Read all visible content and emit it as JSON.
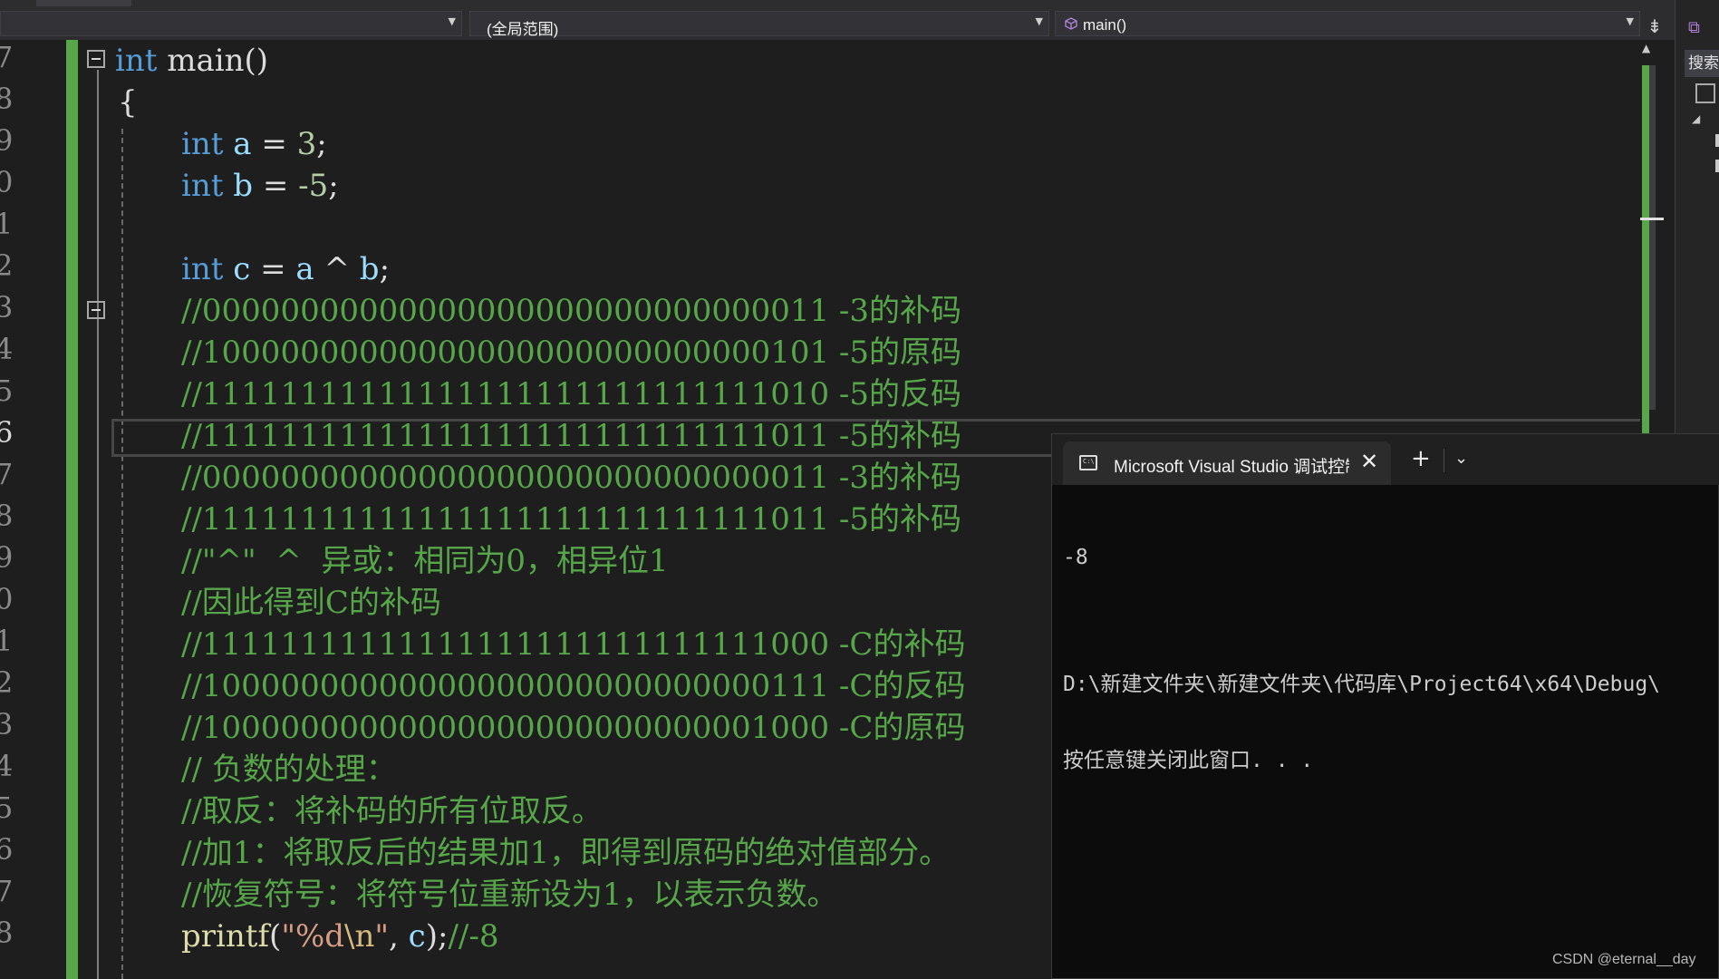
{
  "navbar": {
    "project_dropdown": "",
    "scope_dropdown": "(全局范围)",
    "member_dropdown": "main()"
  },
  "gutter": {
    "line_numbers": [
      "7",
      "8",
      "9",
      "0",
      "1",
      "2",
      "3",
      "4",
      "5",
      "6",
      "7",
      "8",
      "9",
      "0",
      "1",
      "2",
      "3",
      "4",
      "5",
      "6",
      "7",
      "8"
    ],
    "current_index": 9
  },
  "code": {
    "l1": {
      "kw": "int",
      "rest": " main()"
    },
    "l2": {
      "text": "{"
    },
    "l3": {
      "kw": "int",
      "var": "a",
      "op": " = ",
      "num": "3",
      "end": ";"
    },
    "l4": {
      "kw": "int",
      "var": "b",
      "op": " = ",
      "num": "-5",
      "end": ";"
    },
    "l6": {
      "kw": "int",
      "var": "c",
      "op1": " = ",
      "v2": "a",
      "op2": " ^ ",
      "v3": "b",
      "end": ";"
    },
    "comments": [
      "//00000000000000000000000000000011 -3的补码",
      "//10000000000000000000000000000101 -5的原码",
      "//11111111111111111111111111111010 -5的反码",
      "//11111111111111111111111111111011 -5的补码",
      "//00000000000000000000000000000011 -3的补码",
      "//11111111111111111111111111111011 -5的补码",
      "//\"^\"  ^  异或：相同为0，相异位1",
      "//因此得到C的补码",
      "//11111111111111111111111111111000 -C的补码",
      "//10000000000000000000000000000111 -C的反码",
      "//10000000000000000000000000001000 -C的原码",
      "// 负数的处理：",
      "//取反：将补码的所有位取反。",
      "//加1：将取反后的结果加1，即得到原码的绝对值部分。",
      "//恢复符号：将符号位重新设为1，以表示负数。"
    ],
    "printf": {
      "fn": "printf",
      "p1": "(",
      "fmt1": "\"%d",
      "esc": "\\n",
      "fmt2": "\"",
      "sep": ", ",
      "var": "c",
      "end": ");",
      "cm": "//-8"
    }
  },
  "right_panel": {
    "search_label": "搜索"
  },
  "terminal": {
    "tab_title": "Microsoft Visual Studio 调试控制台",
    "close_glyph": "✕",
    "plus_glyph": "+",
    "chevron_glyph": "⌄",
    "output_lines": [
      "-8",
      "",
      "D:\\新建文件夹\\新建文件夹\\代码库\\Project64\\x64\\Debug\\",
      "按任意键关闭此窗口. . ."
    ]
  },
  "watermark": "CSDN @eternal__day",
  "colors": {
    "keyword": "#569cd6",
    "variable": "#9cdcfe",
    "number": "#b5cea8",
    "comment": "#57a64a",
    "function": "#dcdcaa",
    "string": "#d69d85"
  }
}
